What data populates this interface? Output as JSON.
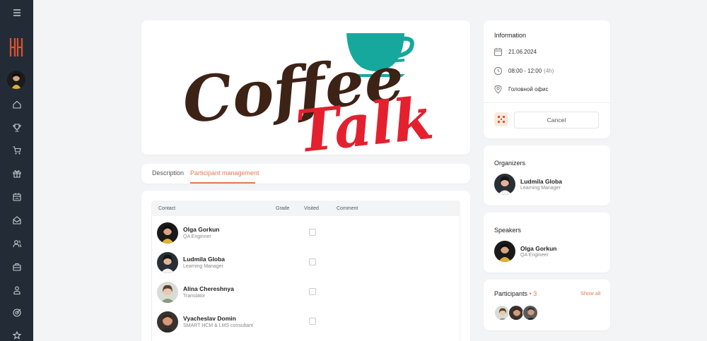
{
  "sidebar": {
    "icons": [
      "menu-icon",
      "home-icon",
      "trophy-icon",
      "cart-icon",
      "gift-icon",
      "calendar-icon",
      "mail-icon",
      "users-icon",
      "briefcase-icon",
      "user-icon",
      "target-icon",
      "star-icon"
    ],
    "accent": "#e0502d"
  },
  "banner": {
    "line1": "Coffee",
    "line2": "Talk",
    "colors": {
      "coffee": "#3d2216",
      "talk": "#e4202f",
      "cup": "#16a89c"
    }
  },
  "tabs": {
    "description": "Description",
    "participants": "Participant management"
  },
  "table": {
    "headers": {
      "contact": "Contact",
      "grade": "Grade",
      "visited": "Visited",
      "comment": "Comment"
    },
    "rows": [
      {
        "name": "Olga Gorkun",
        "role": "QA Enginner"
      },
      {
        "name": "Ludmila Globa",
        "role": "Learning Manager"
      },
      {
        "name": "Alina Chereshnya",
        "role": "Translator"
      },
      {
        "name": "Vyacheslav Domin",
        "role": "SMART HCM & LMS consultant"
      }
    ]
  },
  "information": {
    "title": "Information",
    "date": "21.06.2024",
    "time": "08:00 - 12:00",
    "duration": "(4h)",
    "location": "Головной офис",
    "cancel_label": "Cancel"
  },
  "organizers": {
    "title": "Organizers",
    "name": "Ludmila Globa",
    "role": "Learning Manager"
  },
  "speakers": {
    "title": "Speakers",
    "name": "Olga Gorkun",
    "role": "QA Engineer"
  },
  "participants": {
    "title": "Participants",
    "separator": "•",
    "count": "3",
    "show_all": "Show all"
  },
  "colors": {
    "accent": "#e07a52",
    "sidebar_bg": "#232c36",
    "page_bg": "#f3f4f6"
  }
}
